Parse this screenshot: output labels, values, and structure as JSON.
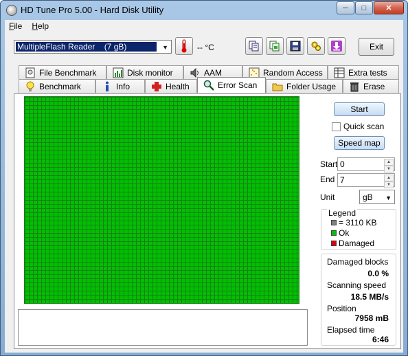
{
  "window": {
    "title": "HD Tune Pro 5.00 - Hard Disk Utility"
  },
  "menu": {
    "file": "File",
    "help": "Help"
  },
  "toolbar": {
    "drive": "MultipleFlash Reader    (7 gB)",
    "temperature": "-- °C",
    "exit_label": "Exit",
    "icons": [
      "thermometer-icon",
      "copy-info-icon",
      "copy-screenshot-icon",
      "save-icon",
      "options-icon",
      "download-icon"
    ]
  },
  "tabs": {
    "row1": [
      "File Benchmark",
      "Disk monitor",
      "AAM",
      "Random Access",
      "Extra tests"
    ],
    "row2": [
      "Benchmark",
      "Info",
      "Health",
      "Error Scan",
      "Folder Usage",
      "Erase"
    ],
    "active": "Error Scan"
  },
  "scan": {
    "start_label": "Start",
    "quick_scan_label": "Quick scan",
    "speed_map_label": "Speed map",
    "start_field_label": "Start",
    "start_value": "0",
    "end_field_label": "End",
    "end_value": "7",
    "unit_label": "Unit",
    "unit_value": "gB"
  },
  "legend": {
    "title": "Legend",
    "block_size": "= 3110 KB",
    "ok": "Ok",
    "damaged": "Damaged",
    "colors": {
      "block": "#808080",
      "ok": "#00c000",
      "damaged": "#e00000"
    }
  },
  "stats": {
    "damaged_blocks_label": "Damaged blocks",
    "damaged_blocks_value": "0.0 %",
    "scanning_speed_label": "Scanning speed",
    "scanning_speed_value": "18.5 MB/s",
    "position_label": "Position",
    "position_value": "7958 mB",
    "elapsed_label": "Elapsed time",
    "elapsed_value": "6:46"
  }
}
